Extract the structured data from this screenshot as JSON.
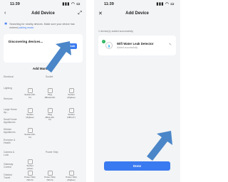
{
  "left": {
    "status": {
      "time": "11:39",
      "icons": "▮▮▮ ◠ ▭"
    },
    "nav": {
      "back": "‹",
      "title": "Add Device",
      "expand": "⤢"
    },
    "notice": {
      "icon": "✱",
      "text": "Searching for nearby devices. Make sure your device has entered",
      "link": "pairing mode."
    },
    "discovering": {
      "label": "Discovering devices...",
      "add": "Add"
    },
    "manual_title": "Add Manually",
    "categories": [
      {
        "name": "Electrical",
        "sub": "Socket"
      },
      {
        "name": "Lighting",
        "sub": ""
      },
      {
        "name": "Sensors",
        "sub": ""
      },
      {
        "name": "Large Home Ap...",
        "sub": ""
      },
      {
        "name": "Small Home Appliances",
        "sub": ""
      },
      {
        "name": "Kitchen Appliances",
        "sub": ""
      },
      {
        "name": "Exercise & Health",
        "sub": ""
      },
      {
        "name": "Camera & Lock",
        "sub": "Power Strip"
      },
      {
        "name": "Gateway Control",
        "sub": ""
      },
      {
        "name": "Outdoor Travel",
        "sub": ""
      }
    ],
    "devices": [
      {
        "label": "Socket (Wi-Fi)"
      },
      {
        "label": "Plug (Bluetooth)"
      },
      {
        "label": "Socket (Zigbee)"
      },
      {
        "label": "Socket (Zigbee)"
      },
      {
        "label": "Plug (BLE+Wi-Fi)"
      },
      {
        "label": "Socket (NB-IoT)"
      },
      {
        "label": "Socket (Wi-Fi)"
      },
      {
        "label": "Socket (other)"
      },
      {
        "label": "Power Strip (Wi-Fi)"
      },
      {
        "label": "Power Strip (Wi-Fi)"
      },
      {
        "label": "Power Strip (Zigbee)"
      }
    ]
  },
  "right": {
    "status": {
      "time": "11:39",
      "icons": "▮▮▮ ◠ ▭"
    },
    "nav": {
      "close": "✕",
      "title": "Add Device"
    },
    "added_label": "1 device(s) added successfully",
    "device": {
      "name": "Wifi Water Leak Detector",
      "sub": "Added successfully",
      "icon": "💧",
      "check": "✓",
      "edit": "✎"
    },
    "done": "Done"
  },
  "colors": {
    "accent": "#3a7af0",
    "success": "#27b35a",
    "arrow": "#4a86c8"
  }
}
